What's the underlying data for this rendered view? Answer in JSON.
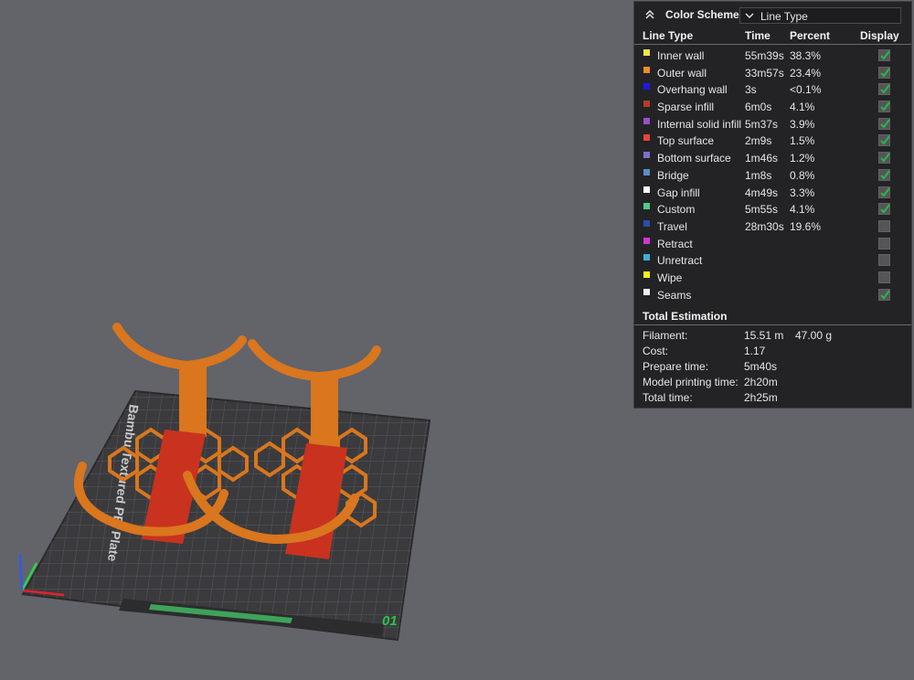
{
  "color_scheme": {
    "title": "Color Scheme",
    "selected": "Line Type"
  },
  "table": {
    "headers": {
      "line_type": "Line Type",
      "time": "Time",
      "percent": "Percent",
      "display": "Display"
    },
    "rows": [
      {
        "name": "Inner wall",
        "time": "55m39s",
        "percent": "38.3%",
        "color": "#f2e44a",
        "display": true
      },
      {
        "name": "Outer wall",
        "time": "33m57s",
        "percent": "23.4%",
        "color": "#ef8a2f",
        "display": true
      },
      {
        "name": "Overhang wall",
        "time": "3s",
        "percent": "<0.1%",
        "color": "#1a1ae6",
        "display": true
      },
      {
        "name": "Sparse infill",
        "time": "6m0s",
        "percent": "4.1%",
        "color": "#b83a2a",
        "display": true
      },
      {
        "name": "Internal solid infill",
        "time": "5m37s",
        "percent": "3.9%",
        "color": "#9a4fc7",
        "display": true
      },
      {
        "name": "Top surface",
        "time": "2m9s",
        "percent": "1.5%",
        "color": "#e8443a",
        "display": true
      },
      {
        "name": "Bottom surface",
        "time": "1m46s",
        "percent": "1.2%",
        "color": "#7a72c6",
        "display": true
      },
      {
        "name": "Bridge",
        "time": "1m8s",
        "percent": "0.8%",
        "color": "#5c8cc8",
        "display": true
      },
      {
        "name": "Gap infill",
        "time": "4m49s",
        "percent": "3.3%",
        "color": "#ffffff",
        "display": true
      },
      {
        "name": "Custom",
        "time": "5m55s",
        "percent": "4.1%",
        "color": "#4ecb8a",
        "display": true
      },
      {
        "name": "Travel",
        "time": "28m30s",
        "percent": "19.6%",
        "color": "#2e4da8",
        "display": false
      },
      {
        "name": "Retract",
        "time": "",
        "percent": "",
        "color": "#d433d4",
        "display": false
      },
      {
        "name": "Unretract",
        "time": "",
        "percent": "",
        "color": "#3fb0d8",
        "display": false
      },
      {
        "name": "Wipe",
        "time": "",
        "percent": "",
        "color": "#f5f21a",
        "display": false
      },
      {
        "name": "Seams",
        "time": "",
        "percent": "",
        "color": "#f0f0f0",
        "display": true
      }
    ]
  },
  "total": {
    "title": "Total Estimation",
    "rows": [
      {
        "label": "Filament:",
        "value": "15.51 m",
        "value2": "47.00 g"
      },
      {
        "label": "Cost:",
        "value": "1.17",
        "value2": ""
      },
      {
        "label": "Prepare time:",
        "value": "5m40s",
        "value2": ""
      },
      {
        "label": "Model printing time:",
        "value": "2h20m",
        "value2": ""
      },
      {
        "label": "Total time:",
        "value": "2h25m",
        "value2": ""
      }
    ]
  },
  "plate": {
    "label": "Bambu Textured PEI Plate",
    "number": "01",
    "axis_colors": {
      "x": "#e0242a",
      "y": "#2bd44a",
      "z": "#2f5be6"
    }
  }
}
